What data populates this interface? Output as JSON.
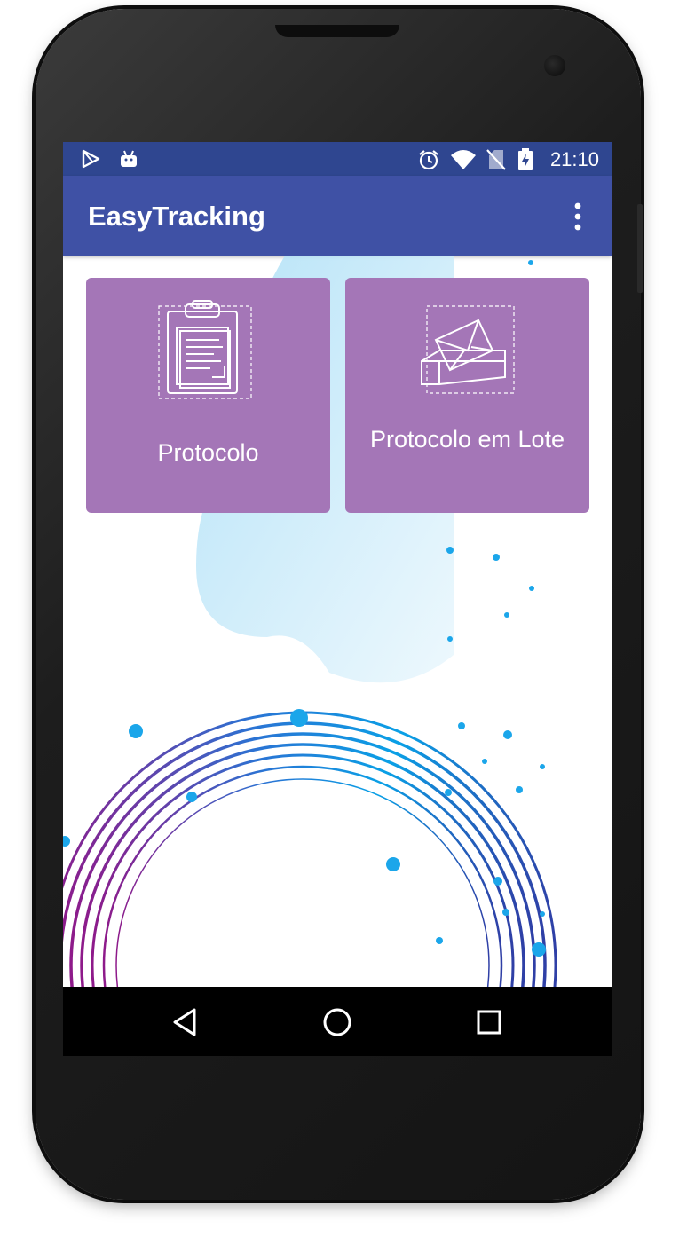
{
  "status_bar": {
    "time": "21:10",
    "icons": [
      "play-store-icon",
      "android-debug-icon",
      "alarm-icon",
      "wifi-icon",
      "no-sim-icon",
      "battery-charging-icon"
    ]
  },
  "app_bar": {
    "title": "EasyTracking",
    "menu_icon": "more-vert-icon"
  },
  "tiles": [
    {
      "label": "Protocolo",
      "icon": "clipboard-icon"
    },
    {
      "label": "Protocolo em Lote",
      "icon": "envelope-box-icon"
    }
  ],
  "nav_bar": {
    "buttons": [
      "back-icon",
      "home-icon",
      "recents-icon"
    ]
  },
  "colors": {
    "status_bar": "#2f4690",
    "app_bar": "#3f51a5",
    "tile": "#a476b7",
    "accent_blue": "#0aa0e6",
    "accent_purple": "#8e1a8a"
  }
}
